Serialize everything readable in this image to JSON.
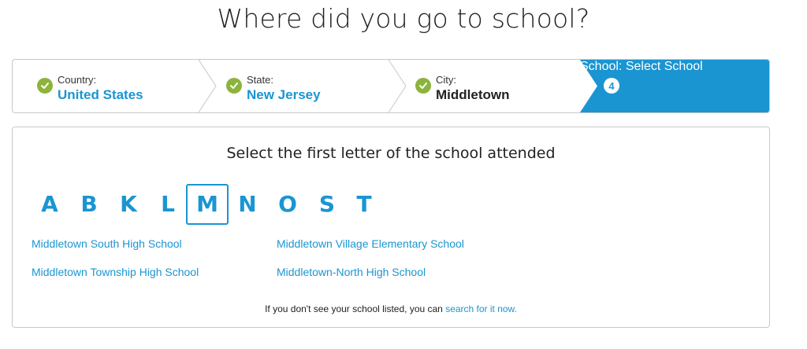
{
  "page": {
    "title": "Where did you go to school?"
  },
  "stepper": {
    "steps": [
      {
        "label": "Country:",
        "value": "United States"
      },
      {
        "label": "State:",
        "value": "New Jersey"
      },
      {
        "label": "City:",
        "value": "Middletown"
      },
      {
        "number": "4",
        "label": "School:",
        "value": "Select School"
      }
    ],
    "colors": {
      "accent": "#1a95d2",
      "check": "#8cb43c",
      "city_value": "#222222"
    }
  },
  "letter_picker": {
    "prompt": "Select the first letter of the school attended",
    "letters": [
      "A",
      "B",
      "K",
      "L",
      "M",
      "N",
      "O",
      "S",
      "T"
    ],
    "selected": "M"
  },
  "schools": [
    "Middletown South High School",
    "Middletown Township High School",
    "Middletown Village Elementary School",
    "Middletown-North High School"
  ],
  "footer": {
    "text": "If you don't see your school listed, you can ",
    "link": "search for it now."
  }
}
